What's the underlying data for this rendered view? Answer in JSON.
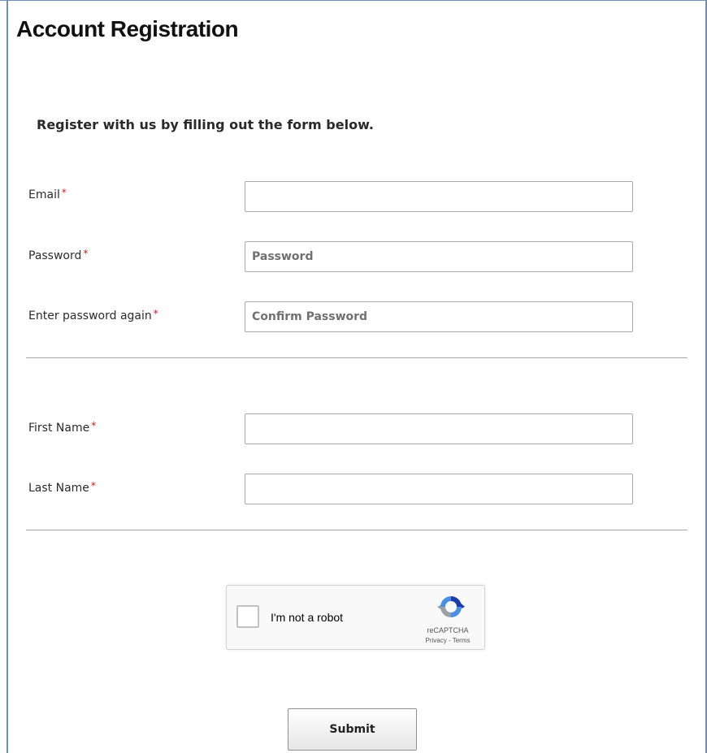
{
  "page": {
    "title": "Account Registration",
    "intro": "Register with us by filling out the form below."
  },
  "form": {
    "required_marker": "*",
    "email": {
      "label": "Email",
      "value": "",
      "placeholder": ""
    },
    "password": {
      "label": "Password",
      "value": "",
      "placeholder": "Password"
    },
    "confirm_password": {
      "label": "Enter password again",
      "value": "",
      "placeholder": "Confirm Password"
    },
    "first_name": {
      "label": "First Name",
      "value": "",
      "placeholder": ""
    },
    "last_name": {
      "label": "Last Name",
      "value": "",
      "placeholder": ""
    }
  },
  "recaptcha": {
    "label": "I'm not a robot",
    "brand": "reCAPTCHA",
    "links": "Privacy - Terms",
    "checked": false,
    "icon": "recaptcha-logo-icon"
  },
  "submit": {
    "label": "Submit"
  },
  "colors": {
    "required": "#d11a1a",
    "frame": "#6f8fb8",
    "divider": "#a7a7a7"
  }
}
